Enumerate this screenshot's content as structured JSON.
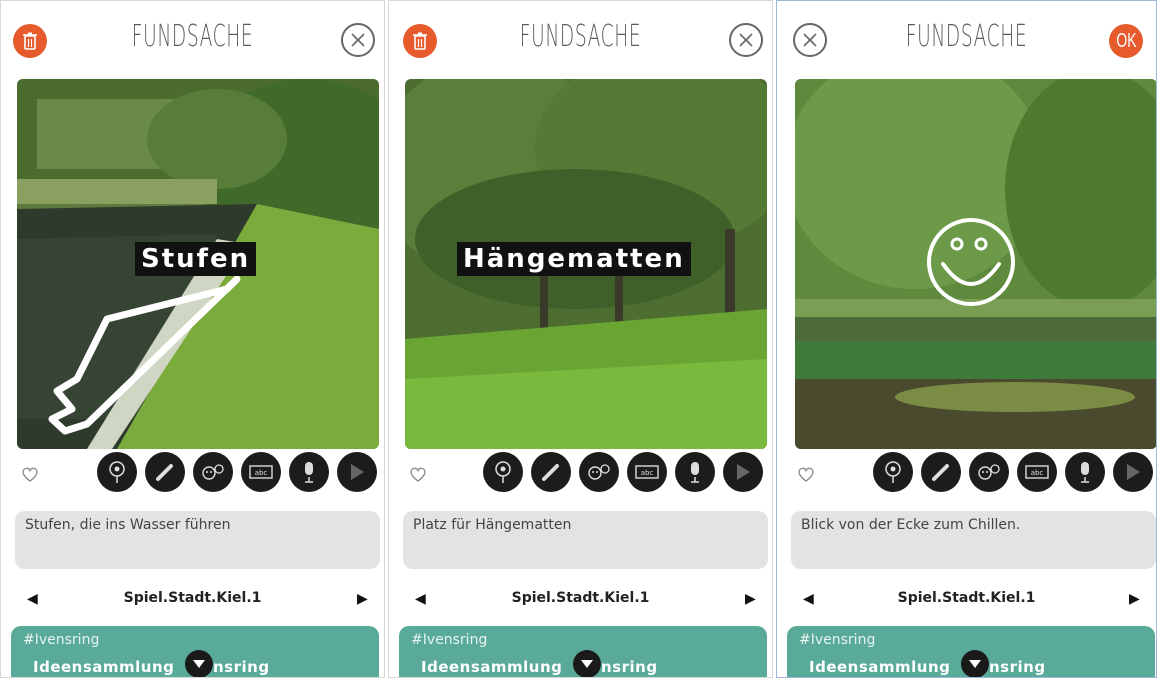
{
  "colors": {
    "accent_red": "#e75a2c",
    "teal": "#5aaa99",
    "tool_bg": "#1c1c1c",
    "desc_bg": "#e3e3e3"
  },
  "screens": [
    {
      "title": "FUNDSACHE",
      "left_icon": "trash-icon",
      "right_icon": "close-icon",
      "photo_label": "Stufen",
      "description": "Stufen, die ins Wasser führen",
      "project": "Spiel.Stadt.Kiel.1",
      "hashtag": "#Ivensring",
      "collection_prefix": "Ideensammlung",
      "collection_suffix": "nsring"
    },
    {
      "title": "FUNDSACHE",
      "left_icon": "trash-icon",
      "right_icon": "close-icon",
      "photo_label": "Hängematten",
      "description": "Platz für Hängematten",
      "project": "Spiel.Stadt.Kiel.1",
      "hashtag": "#Ivensring",
      "collection_prefix": "Ideensammlung",
      "collection_suffix": "nsring"
    },
    {
      "title": "FUNDSACHE",
      "left_icon": "close-icon",
      "right_label": "OK",
      "photo_label": "",
      "description": "Blick von der Ecke zum Chillen.",
      "project": "Spiel.Stadt.Kiel.1",
      "hashtag": "#Ivensring",
      "collection_prefix": "Ideensammlung",
      "collection_suffix": "nsring"
    }
  ],
  "toolbar_icons": [
    "location-pin-icon",
    "pencil-icon",
    "emoji-sticker-icon",
    "text-box-icon",
    "microphone-icon",
    "play-icon"
  ],
  "pager": {
    "prev": "◀",
    "next": "▶"
  }
}
